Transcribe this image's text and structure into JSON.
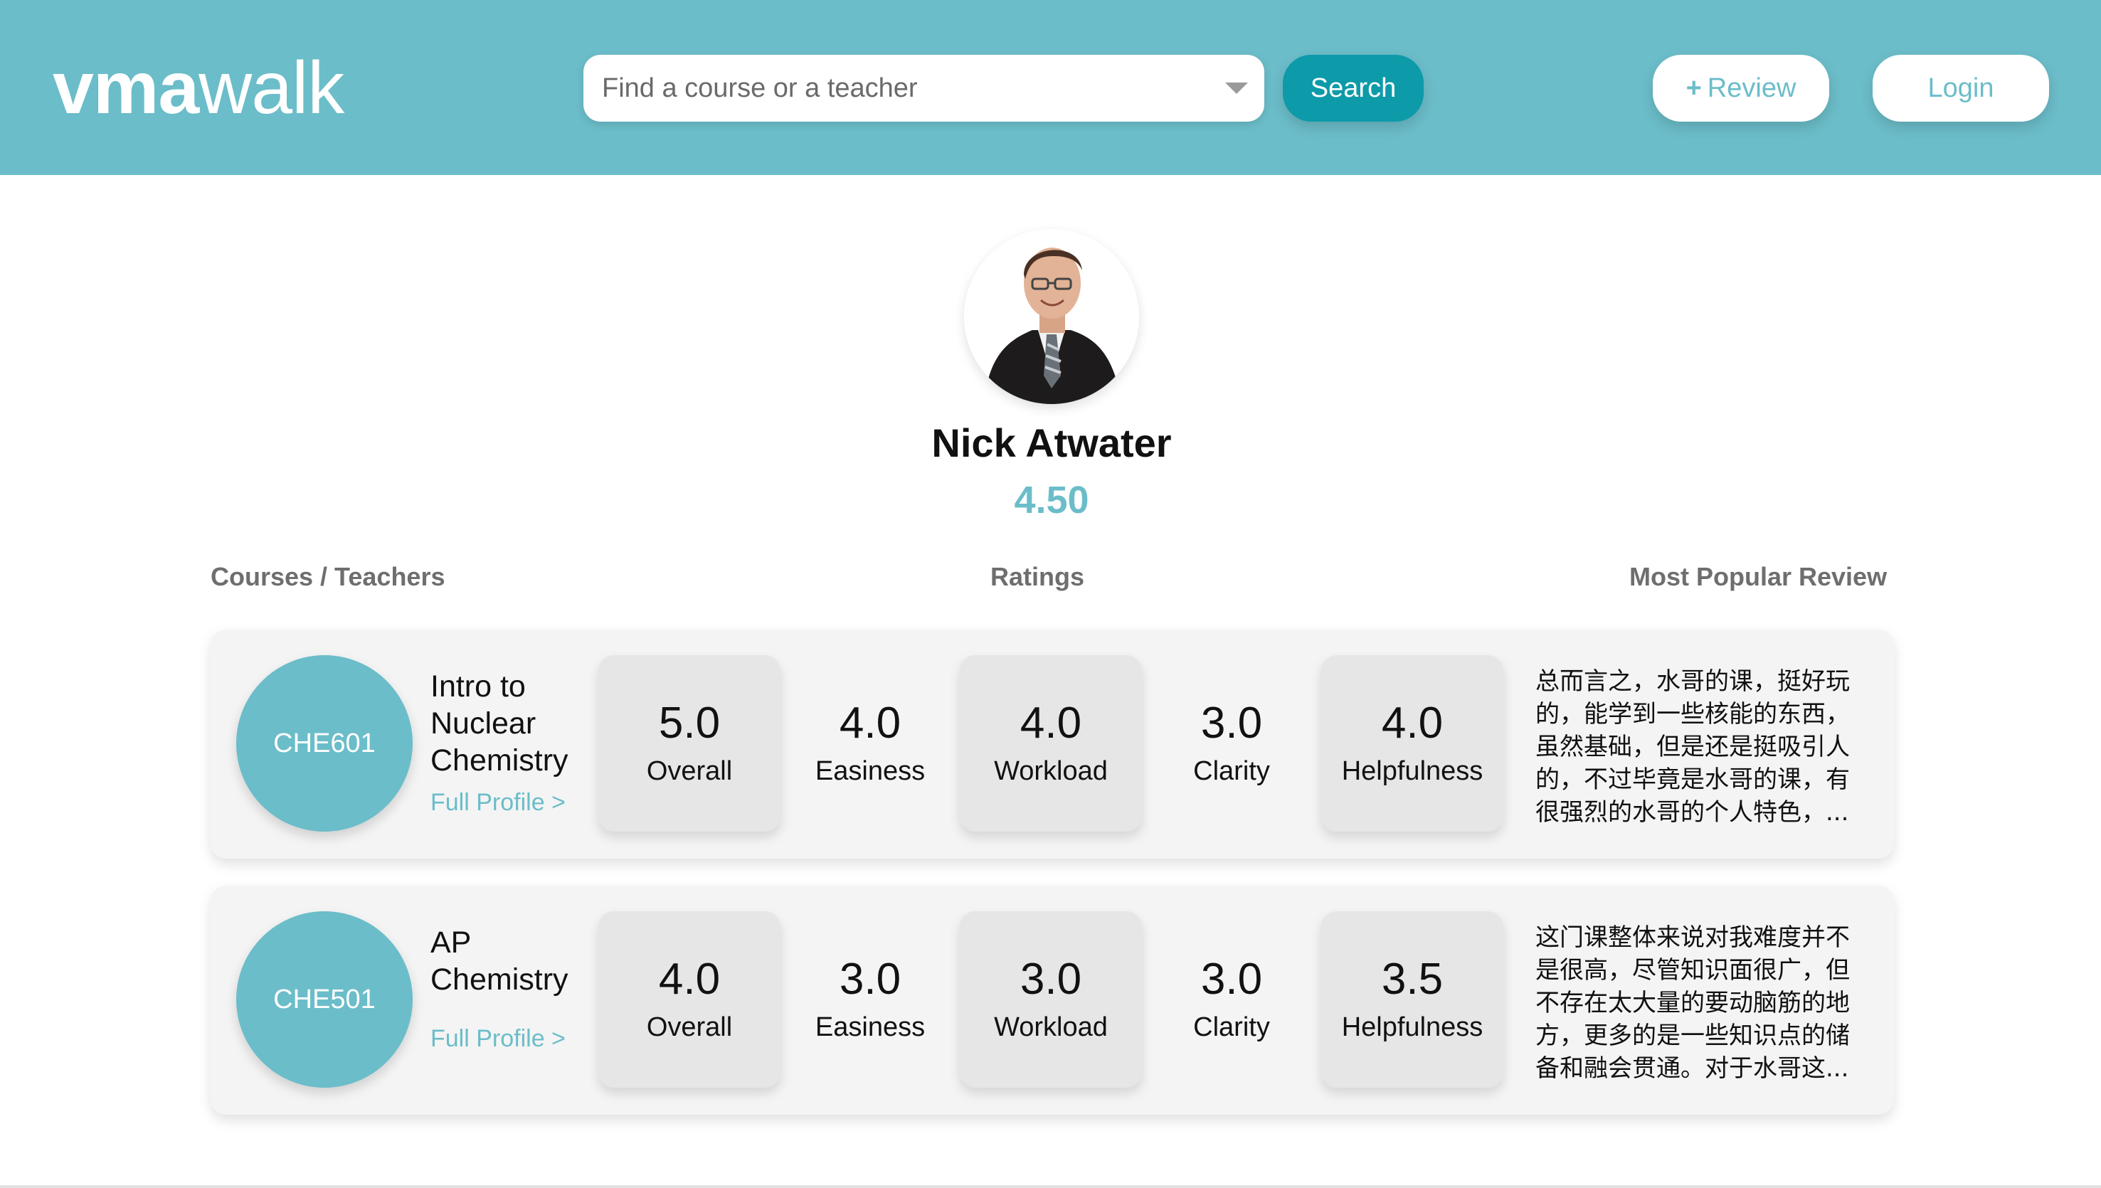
{
  "header": {
    "logo_bold": "vma",
    "logo_light": "walk",
    "search_placeholder": "Find a course or a teacher",
    "search_label": "Search",
    "review_plus": "+",
    "review_label": "Review",
    "login_label": "Login"
  },
  "profile": {
    "name": "Nick Atwater",
    "rating": "4.50"
  },
  "columns": {
    "courses": "Courses / Teachers",
    "ratings": "Ratings",
    "review": "Most Popular Review"
  },
  "courses": [
    {
      "code": "CHE601",
      "name": "Intro to Nuclear Chemistry",
      "link": "Full Profile >",
      "ratings": [
        {
          "value": "5.0",
          "label": "Overall"
        },
        {
          "value": "4.0",
          "label": "Easiness"
        },
        {
          "value": "4.0",
          "label": "Workload"
        },
        {
          "value": "3.0",
          "label": "Clarity"
        },
        {
          "value": "4.0",
          "label": "Helpfulness"
        }
      ],
      "review": "总而言之，水哥的课，挺好玩的，能学到一些核能的东西，虽然基础，但是还是挺吸引人的，不过毕竟是水哥的课，有很强烈的水哥的个人特色，..."
    },
    {
      "code": "CHE501",
      "name": "AP Chemistry",
      "link": "Full Profile >",
      "ratings": [
        {
          "value": "4.0",
          "label": "Overall"
        },
        {
          "value": "3.0",
          "label": "Easiness"
        },
        {
          "value": "3.0",
          "label": "Workload"
        },
        {
          "value": "3.0",
          "label": "Clarity"
        },
        {
          "value": "3.5",
          "label": "Helpfulness"
        }
      ],
      "review": "这门课整体来说对我难度并不是很高，尽管知识面很广，但不存在太大量的要动脑筋的地方，更多的是一些知识点的储备和融会贯通。对于水哥这..."
    }
  ],
  "colors": {
    "accent": "#6bbdc9",
    "search_button": "#0d9aa9",
    "card": "#e6e6e6",
    "row": "#f4f4f4"
  }
}
